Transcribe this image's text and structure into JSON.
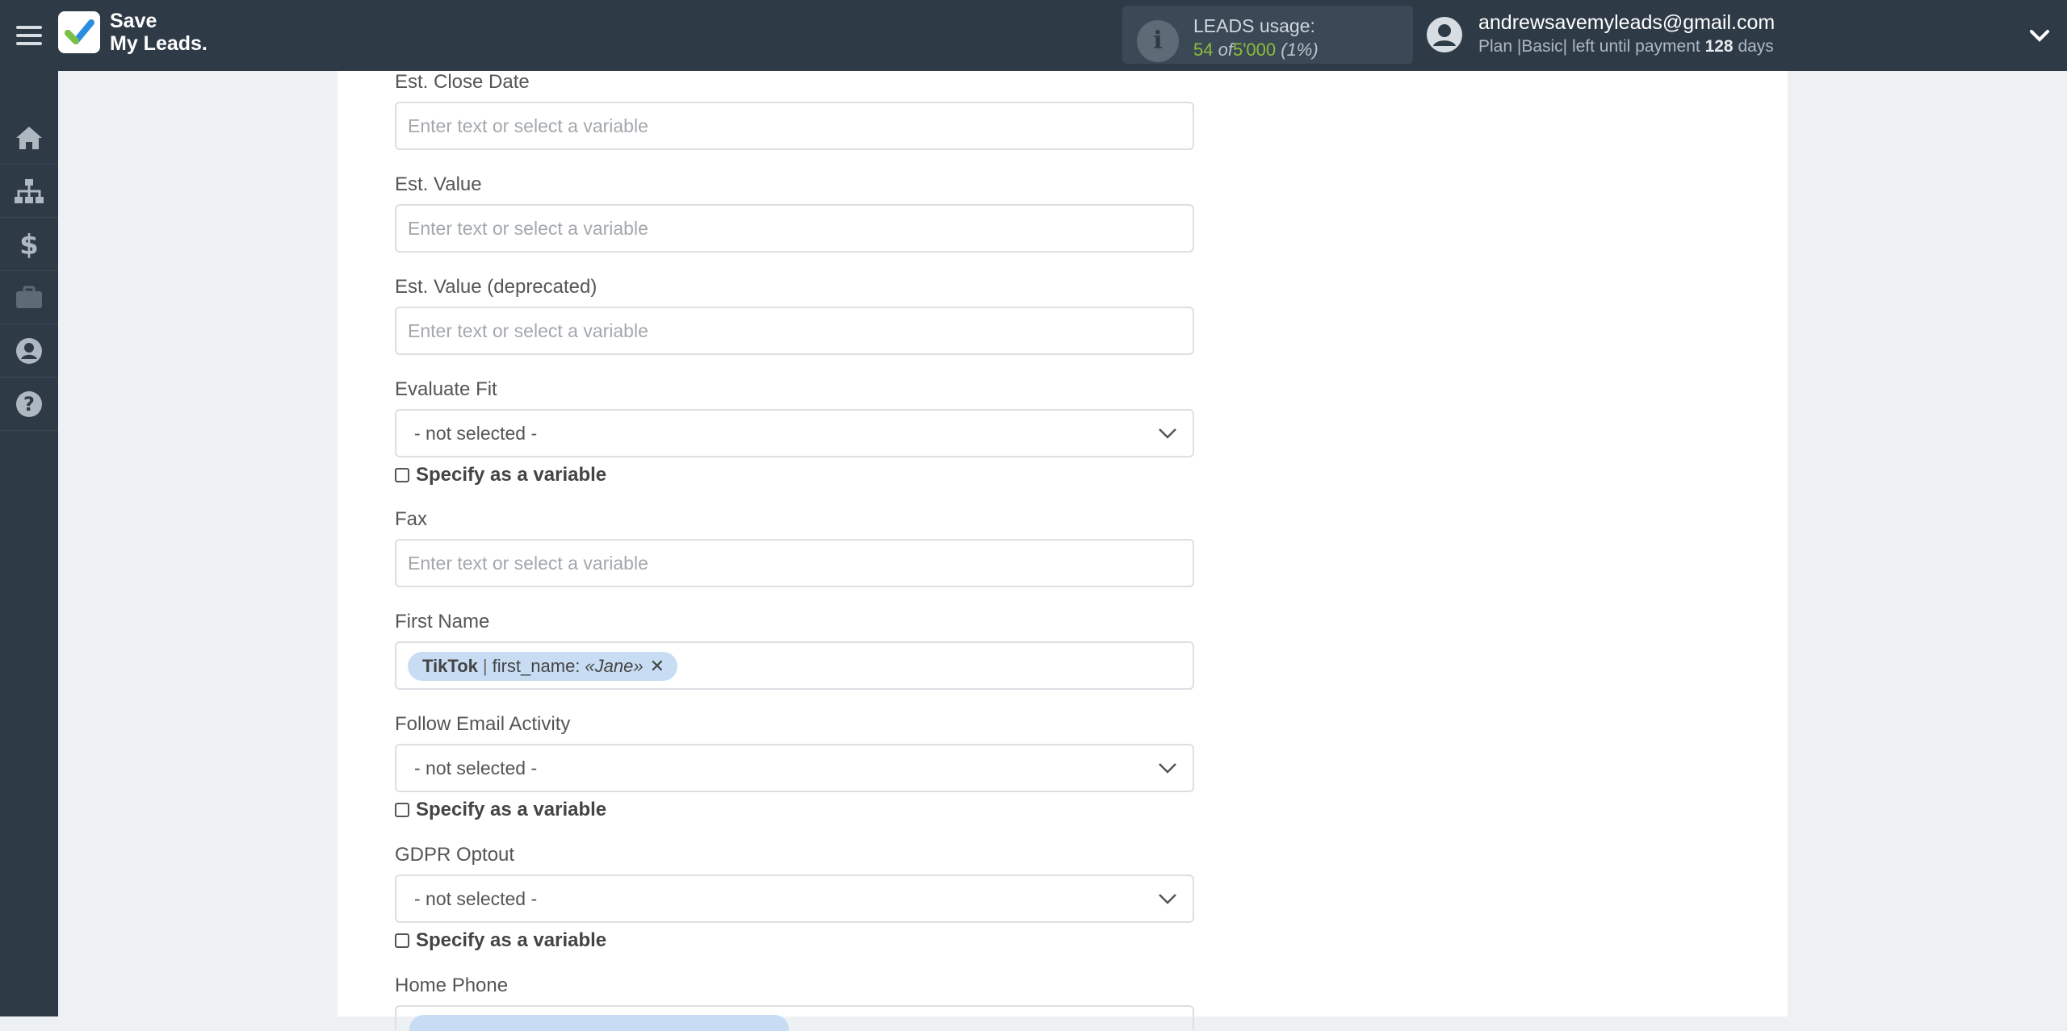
{
  "header": {
    "logo_line1": "Save",
    "logo_line2": "My Leads.",
    "usage_label": "LEADS usage:",
    "usage_used": "54",
    "usage_of": "of",
    "usage_total": "5'000",
    "usage_pct": "(1%)",
    "user_email": "andrewsavemyleads@gmail.com",
    "plan_prefix": "Plan |Basic| left until payment",
    "plan_days": "128",
    "plan_suffix": "days"
  },
  "sidebar": {
    "items": [
      "home-icon",
      "sitemap-icon",
      "dollar-icon",
      "briefcase-icon",
      "user-circle-icon",
      "help-icon"
    ]
  },
  "form": {
    "est_close_date": {
      "label": "Est. Close Date",
      "placeholder": "Enter text or select a variable"
    },
    "est_value": {
      "label": "Est. Value",
      "placeholder": "Enter text or select a variable"
    },
    "est_value_deprecated": {
      "label": "Est. Value (deprecated)",
      "placeholder": "Enter text or select a variable"
    },
    "evaluate_fit": {
      "label": "Evaluate Fit",
      "value": "- not selected -",
      "specify_label": "Specify as a variable"
    },
    "fax": {
      "label": "Fax",
      "placeholder": "Enter text or select a variable"
    },
    "first_name": {
      "label": "First Name",
      "tag_source": "TikTok",
      "tag_sep": "|",
      "tag_field": "first_name:",
      "tag_value": "«Jane»",
      "tag_remove": "✕"
    },
    "follow_email_activity": {
      "label": "Follow Email Activity",
      "value": "- not selected -",
      "specify_label": "Specify as a variable"
    },
    "gdpr_optout": {
      "label": "GDPR Optout",
      "value": "- not selected -",
      "specify_label": "Specify as a variable"
    },
    "home_phone": {
      "label": "Home Phone"
    }
  },
  "colors": {
    "topbar": "#2e3b47",
    "accent_green": "#8bbd39",
    "tag_bg": "#c8ddf4"
  }
}
